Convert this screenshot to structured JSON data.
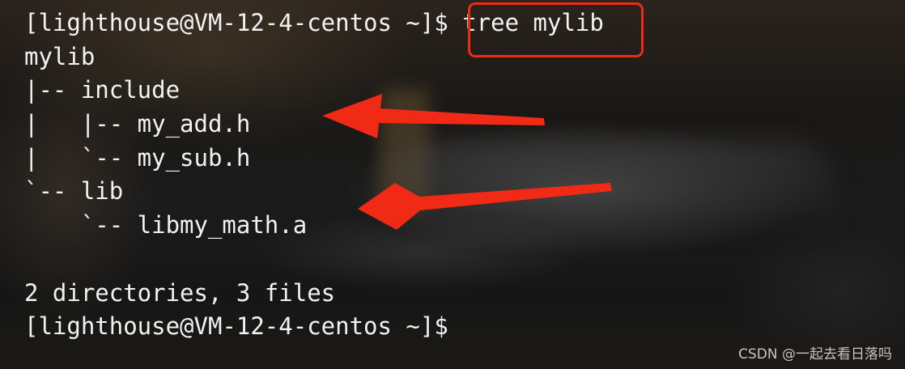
{
  "terminal": {
    "lines": [
      {
        "prompt": "[lighthouse@VM-12-4-centos ~]$ ",
        "command": "tree mylib"
      },
      {
        "text": "mylib"
      },
      {
        "text": "|-- include"
      },
      {
        "text": "|   |-- my_add.h"
      },
      {
        "text": "|   `-- my_sub.h"
      },
      {
        "text": "`-- lib"
      },
      {
        "text": "    `-- libmy_math.a"
      },
      {
        "text": ""
      },
      {
        "text": "2 directories, 3 files"
      },
      {
        "text": "[lighthouse@VM-12-4-centos ~]$"
      }
    ]
  },
  "annotations": {
    "highlight_icon": "red-highlight-box",
    "arrow_icon": "red-arrow",
    "accent_color": "#f02a15"
  },
  "watermark": {
    "text": "CSDN @一起去看日落吗"
  }
}
